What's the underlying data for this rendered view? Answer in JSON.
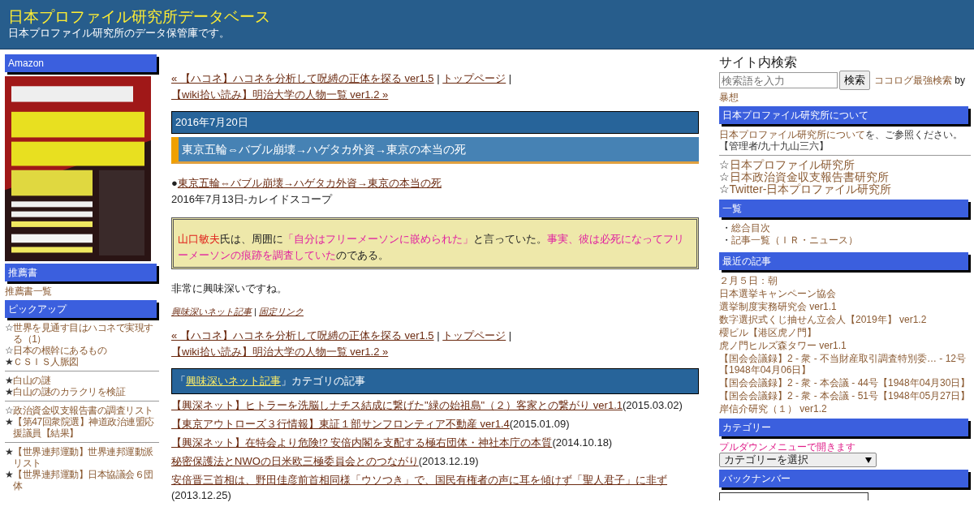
{
  "header": {
    "title": "日本プロファイル研究所データベース",
    "subtitle": "日本プロファイル研究所のデータ保管庫です。"
  },
  "left": {
    "amazon_heading": "Amazon",
    "cover": {
      "kind": "picture"
    },
    "books_heading": "推薦書",
    "books_link": "推薦書一覧",
    "pickup_heading": "ピックアップ",
    "pickup_groups": [
      [
        {
          "mark": "☆",
          "text": "世界を見通す目はハコネで実現する（1）"
        },
        {
          "mark": "☆",
          "text": "日本の根幹にあるもの"
        },
        {
          "mark": "★",
          "text": "ＣＳＩＳ人脈図"
        }
      ],
      [
        {
          "mark": "★",
          "text": "白山の謎"
        },
        {
          "mark": "★",
          "text": "白山の謎のカラクリを検証"
        }
      ],
      [
        {
          "mark": "☆",
          "text": "政治資金収支報告書の調査リスト"
        },
        {
          "mark": "★",
          "text": "【第47回衆院選】神道政治連盟応援議員【結果】"
        }
      ],
      [
        {
          "mark": "★",
          "text": "【世界連邦運動】世界連邦運動派リスト"
        },
        {
          "mark": "★",
          "text": "【世界連邦運動】日本協議会６団体"
        }
      ]
    ]
  },
  "main": {
    "nav_top": {
      "prev": "« 【ハコネ】ハコネを分析して呪縛の正体を探る ver1.5",
      "top": "トップページ",
      "next": "【wiki拾い読み】明治大学の人物一覧 ver1.2 »",
      "separator": "|"
    },
    "date": "2016年7月20日",
    "post_title": "東京五輪⇔バブル崩壊→ハゲタカ外資→東京の本当の死",
    "source_bullet": "●",
    "source_link": "東京五輪⇔バブル崩壊→ハゲタカ外資→東京の本当の死",
    "source_meta": "2016年7月13日-カレイドスコープ",
    "quote": [
      {
        "text": "山口敏夫",
        "color": "#e0201a"
      },
      {
        "text": "氏は、周囲に"
      },
      {
        "text": "「自分はフリーメーソンに嵌められた」",
        "color": "#e020a0"
      },
      {
        "text": "と言っていた。"
      },
      {
        "text": "事実、彼は必死になってフリーメーソンの痕跡を調査していた",
        "color": "#e020a0"
      },
      {
        "text": "のである。"
      }
    ],
    "comment": "非常に興味深いですね。",
    "footer": {
      "category": "興味深いネット記事",
      "separator": "|",
      "permalink": "固定リンク"
    },
    "nav_bottom": {
      "prev": "« 【ハコネ】ハコネを分析して呪縛の正体を探る ver1.5",
      "top": "トップページ",
      "next": "【wiki拾い読み】明治大学の人物一覧 ver1.2 »",
      "separator": "|"
    },
    "category_heading": {
      "open": "「",
      "link": "興味深いネット記事",
      "rest": "」カテゴリの記事"
    },
    "articles": [
      {
        "title": "【興深ネット】ヒトラーを洗脳しナチス結成に繋げた\"緑の始祖島\"（２）客家との繋がり ver1.1",
        "date": "(2015.03.02)"
      },
      {
        "title": "【東京アウトローズ３行情報】東証１部サンフロンティア不動産 ver1.4",
        "date": "(2015.01.09)"
      },
      {
        "title": "【興深ネット】在特会より危険!? 安倍内閣を支配する極右団体・神社本庁の本質",
        "date": "(2014.10.18)"
      },
      {
        "title": "秘密保護法とNWOの日米欧三極委員会とのつながり",
        "date": "(2013.12.19)"
      },
      {
        "title": "安倍晋三首相は、野田佳彦前首相同様「ウソつき」で、国民有権者の声に耳を傾けず「聖人君子」に非ず",
        "date": "(2013.12.25)"
      }
    ]
  },
  "right": {
    "search_title": "サイト内検索",
    "search": {
      "placeholder": "検索語を入力",
      "button": "検索"
    },
    "search_credit": {
      "link": "ココログ最強検索",
      "by": "by",
      "author": "暴想"
    },
    "about_heading": "日本プロファイル研究所について",
    "about_link": "日本プロファイル研究所について",
    "about_rest": "を、ご参照ください。",
    "admin": "【管理者/九十九山三六】",
    "sites": [
      {
        "mark": "☆",
        "text": "日本プロファイル研究所"
      },
      {
        "mark": "☆",
        "text": "日本政治資金収支報告書研究所"
      },
      {
        "mark": "☆",
        "text": "Twitter-日本プロファイル研究所"
      }
    ],
    "index_heading": "一覧",
    "index_items": [
      {
        "mark": "・",
        "text": "総合目次"
      },
      {
        "mark": "・",
        "text": "記事一覧（ＩＲ・ニュース）"
      }
    ],
    "recent_heading": "最近の記事",
    "recent": [
      "２月５日：朝",
      "日本選挙キャンペーン協会",
      "選挙制度実務研究会 ver1.1",
      "数字選択式くじ抽せん立会人【2019年】 ver1.2",
      "櫻ビル【港区虎ノ門】",
      "虎ノ門ヒルズ森タワー ver1.1",
      "【国会会議録】2 - 衆 - 不当財産取引調査特別委… - 12号【1948年04月06日】",
      "【国会会議録】2 - 衆 - 本会議 - 44号【1948年04月30日】",
      "【国会会議録】2 - 衆 - 本会議 - 51号【1948年05月27日】",
      "岸信介研究（１） ver1.2"
    ],
    "category_heading": "カテゴリー",
    "category_note": "プルダウンメニューで開きます",
    "category_select": "カテゴリーを選択",
    "backnumber_heading": "バックナンバー"
  }
}
